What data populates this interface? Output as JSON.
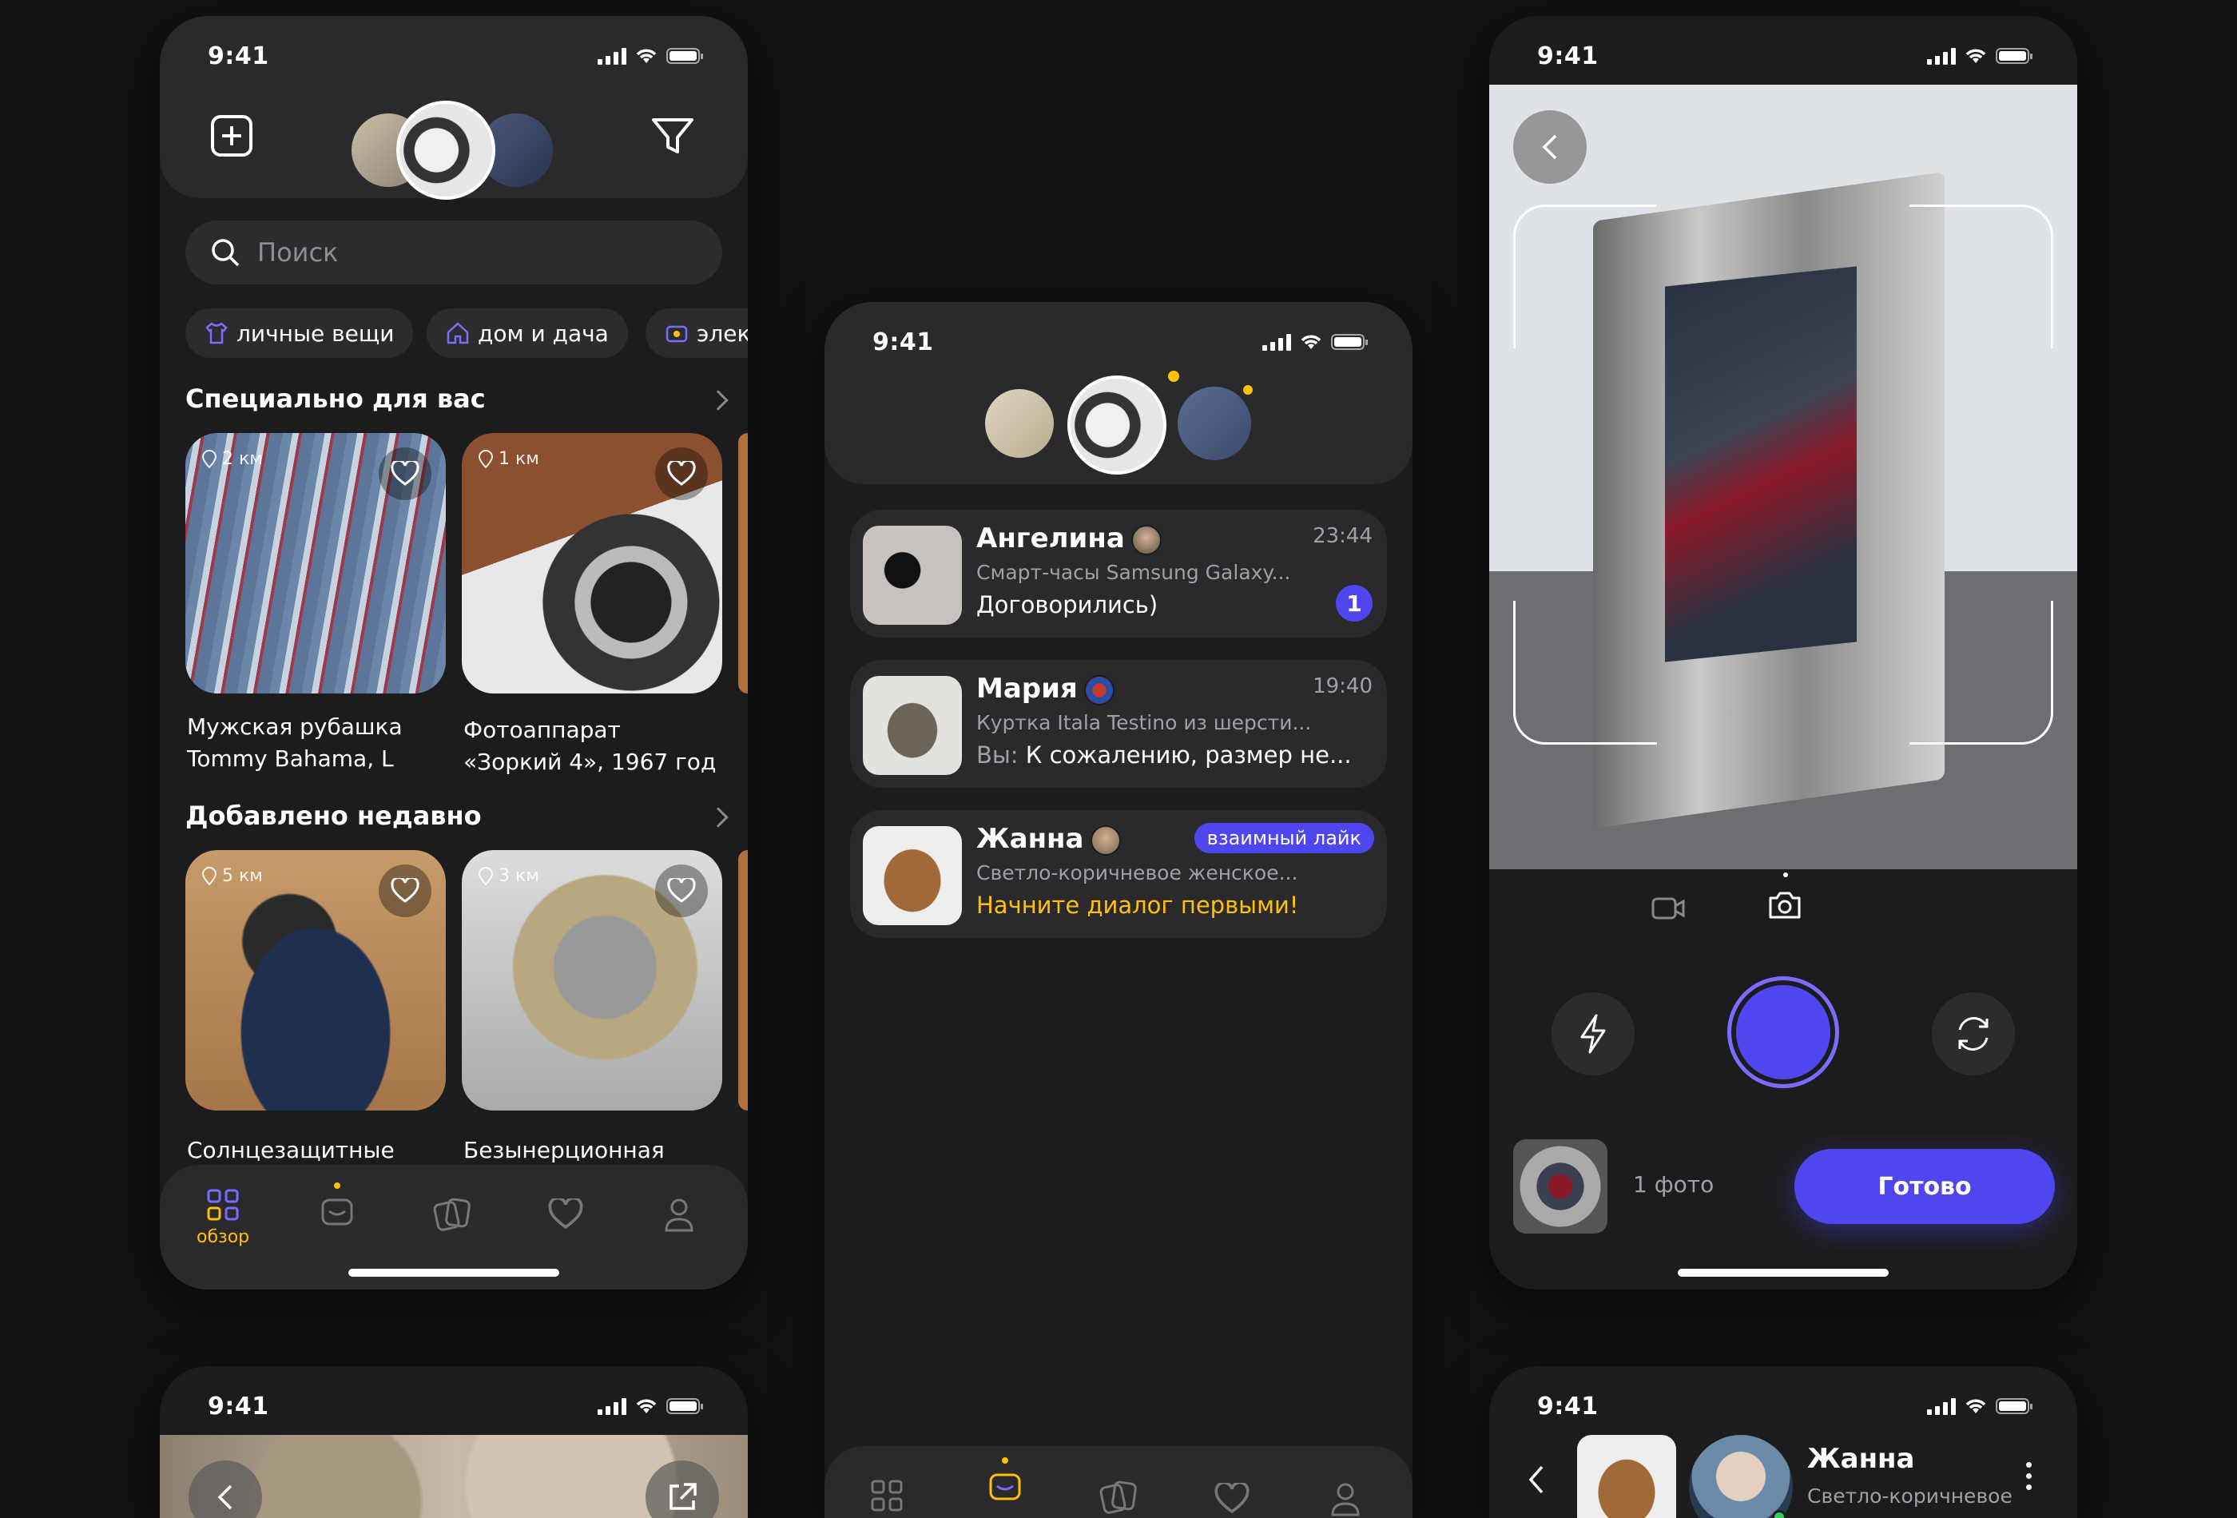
{
  "status": {
    "time": "9:41"
  },
  "browse": {
    "search_placeholder": "Поиск",
    "chips": [
      "личные вещи",
      "дом и дача",
      "элек"
    ],
    "section1": "Специально для вас",
    "section2": "Добавлено недавно",
    "cards1": [
      {
        "dist": "2 км",
        "title": "Мужская рубашка\nTommy Bahama, L"
      },
      {
        "dist": "1 км",
        "title": "Фотоаппарат\n«Зоркий 4», 1967 год"
      }
    ],
    "cards2": [
      {
        "dist": "5 км",
        "title": "Солнцезащитные\nочки Oakley"
      },
      {
        "dist": "3 км",
        "title": "Безынерционная\nкатушка Berkley Trout"
      }
    ],
    "tabs": [
      "обзор"
    ]
  },
  "messages": {
    "items": [
      {
        "name": "Ангелина",
        "time": "23:44",
        "sub": "Смарт-часы Samsung Galaxy...",
        "last": "Договорились)",
        "badge": "1"
      },
      {
        "name": "Мария",
        "time": "19:40",
        "sub": "Куртка Itala Testino из шерсти...",
        "last_prefix": "Вы:",
        "last": "К сожалению, размер не..."
      },
      {
        "name": "Жанна",
        "tag": "взаимный лайк",
        "sub": "Светло-коричневое женское...",
        "last": "Начните диалог первыми!"
      }
    ]
  },
  "camera": {
    "count": "1 фото",
    "done": "Готово"
  },
  "chat": {
    "name": "Жанна",
    "sub": "Светло-коричневое\nженское полупальто"
  },
  "colors": {
    "accent": "#5046f0",
    "yellow": "#ffc107",
    "bg": "#121212",
    "card": "#2a2a2c"
  }
}
